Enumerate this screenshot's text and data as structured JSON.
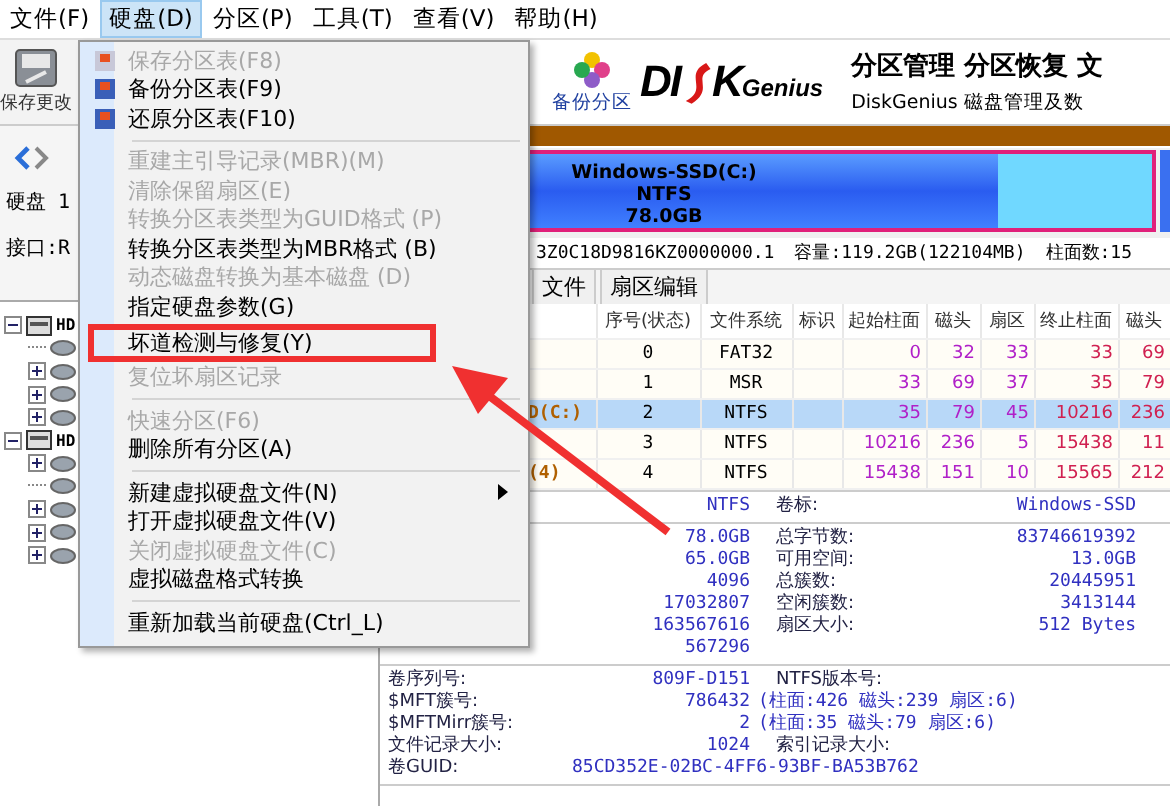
{
  "menubar": [
    {
      "label": "文件(F)",
      "selected": false
    },
    {
      "label": "硬盘(D)",
      "selected": true
    },
    {
      "label": "分区(P)",
      "selected": false
    },
    {
      "label": "工具(T)",
      "selected": false
    },
    {
      "label": "查看(V)",
      "selected": false
    },
    {
      "label": "帮助(H)",
      "selected": false
    }
  ],
  "toolbar": {
    "save_button": "保存更改",
    "backup_button": "备份分区"
  },
  "disk_panel": {
    "disk_label": "硬盘 1",
    "interface_label": "接口:R"
  },
  "tree": [
    {
      "label": "HD",
      "expanded": true,
      "children": [
        {
          "expandable": false
        },
        {
          "expandable": true
        },
        {
          "expandable": true
        },
        {
          "expandable": true
        }
      ]
    },
    {
      "label": "HD",
      "expanded": true,
      "children": [
        {
          "expandable": true
        },
        {
          "expandable": false
        },
        {
          "expandable": true
        },
        {
          "expandable": true
        },
        {
          "expandable": true
        }
      ]
    }
  ],
  "banner": {
    "logo_left": "DI",
    "logo_right": "K",
    "logo_suffix": "Genius",
    "headline": "分区管理 分区恢复 文",
    "subline": "DiskGenius 磁盘管理及数"
  },
  "disk_map": {
    "name": "Windows-SSD(C:)",
    "fs": "NTFS",
    "size": "78.0GB",
    "level": 0.8
  },
  "disk_info": {
    "serial": "3Z0C18D9816KZ0000000.1",
    "capacity": "容量:119.2GB(122104MB)",
    "cylinders": "柱面数:15"
  },
  "tabs": [
    {
      "label": "文件",
      "selected": false
    },
    {
      "label": "扇区编辑",
      "selected": false
    }
  ],
  "table": {
    "columns": [
      "序号(状态)",
      "文件系统",
      "标识",
      "起始柱面",
      "磁头",
      "扇区",
      "终止柱面",
      "磁头"
    ],
    "rows": [
      {
        "index": "0",
        "fs": "FAT32",
        "start_cyl": "0",
        "start_head": "32",
        "start_sector": "33",
        "end_cyl": "33",
        "end_head": "69",
        "selected": false
      },
      {
        "index": "1",
        "fs": "MSR",
        "start_cyl": "33",
        "start_head": "69",
        "start_sector": "37",
        "end_cyl": "35",
        "end_head": "79",
        "selected": false
      },
      {
        "name": "D(C:)",
        "index": "2",
        "fs": "NTFS",
        "start_cyl": "35",
        "start_head": "79",
        "start_sector": "45",
        "end_cyl": "10216",
        "end_head": "236",
        "selected": true
      },
      {
        "index": "3",
        "fs": "NTFS",
        "start_cyl": "10216",
        "start_head": "236",
        "start_sector": "5",
        "end_cyl": "15438",
        "end_head": "11",
        "selected": false
      },
      {
        "name": "(4)",
        "index": "4",
        "fs": "NTFS",
        "start_cyl": "15438",
        "start_head": "151",
        "start_sector": "10",
        "end_cyl": "15565",
        "end_head": "212",
        "selected": false
      }
    ]
  },
  "details": [
    [
      {
        "value": "NTFS",
        "label2": "卷标:",
        "value2": "Windows-SSD"
      }
    ],
    [
      {
        "value": "78.0GB",
        "label2": "总字节数:",
        "value2": "83746619392"
      },
      {
        "value": "65.0GB",
        "label2": "可用空间:",
        "value2": "13.0GB"
      },
      {
        "value": "4096",
        "label2": "总簇数:",
        "value2": "20445951"
      },
      {
        "value": "17032807",
        "label2": "空闲簇数:",
        "value2": "3413144"
      },
      {
        "value": "163567616",
        "label2": "扇区大小:",
        "value2": "512 Bytes"
      },
      {
        "value": "567296"
      }
    ],
    [
      {
        "label": "卷序列号:",
        "value": "809F-D151",
        "label2": "NTFS版本号:"
      },
      {
        "label": "$MFT簇号:",
        "value": "786432",
        "note": "(柱面:426 磁头:239 扇区:6)"
      },
      {
        "label": "$MFTMirr簇号:",
        "value": "2",
        "note": "(柱面:35 磁头:79 扇区:6)"
      },
      {
        "label": "文件记录大小:",
        "value": "1024",
        "label2": "索引记录大小:"
      },
      {
        "label": "卷GUID:",
        "long_value": "85CD352E-02BC-4FF6-93BF-BA53B762"
      }
    ]
  ],
  "menu": [
    {
      "kind": "item",
      "label": "保存分区表(F8)",
      "disabled": true,
      "icon": true
    },
    {
      "kind": "item",
      "label": "备份分区表(F9)",
      "disabled": false,
      "icon": true
    },
    {
      "kind": "item",
      "label": "还原分区表(F10)",
      "disabled": false,
      "icon": true
    },
    {
      "kind": "separator"
    },
    {
      "kind": "item",
      "label": "重建主引导记录(MBR)(M)",
      "disabled": true
    },
    {
      "kind": "item",
      "label": "清除保留扇区(E)",
      "disabled": true
    },
    {
      "kind": "item",
      "label": "转换分区表类型为GUID格式 (P)",
      "disabled": true
    },
    {
      "kind": "item",
      "label": "转换分区表类型为MBR格式 (B)",
      "disabled": false
    },
    {
      "kind": "item",
      "label": "动态磁盘转换为基本磁盘 (D)",
      "disabled": true
    },
    {
      "kind": "item",
      "label": "指定硬盘参数(G)",
      "disabled": false
    },
    {
      "kind": "item",
      "label": "坏道检测与修复(Y)",
      "disabled": false,
      "marked": true
    },
    {
      "kind": "item",
      "label": "复位坏扇区记录",
      "disabled": true
    },
    {
      "kind": "separator"
    },
    {
      "kind": "item",
      "label": "快速分区(F6)",
      "disabled": true
    },
    {
      "kind": "item",
      "label": "删除所有分区(A)",
      "disabled": false
    },
    {
      "kind": "separator"
    },
    {
      "kind": "item",
      "label": "新建虚拟硬盘文件(N)",
      "disabled": false,
      "submenu": true
    },
    {
      "kind": "item",
      "label": "打开虚拟硬盘文件(V)",
      "disabled": false
    },
    {
      "kind": "item",
      "label": "关闭虚拟硬盘文件(C)",
      "disabled": true
    },
    {
      "kind": "item",
      "label": "虚拟磁盘格式转换",
      "disabled": false
    },
    {
      "kind": "separator"
    },
    {
      "kind": "item",
      "label": "重新加载当前硬盘(Ctrl_L)",
      "disabled": false
    }
  ]
}
